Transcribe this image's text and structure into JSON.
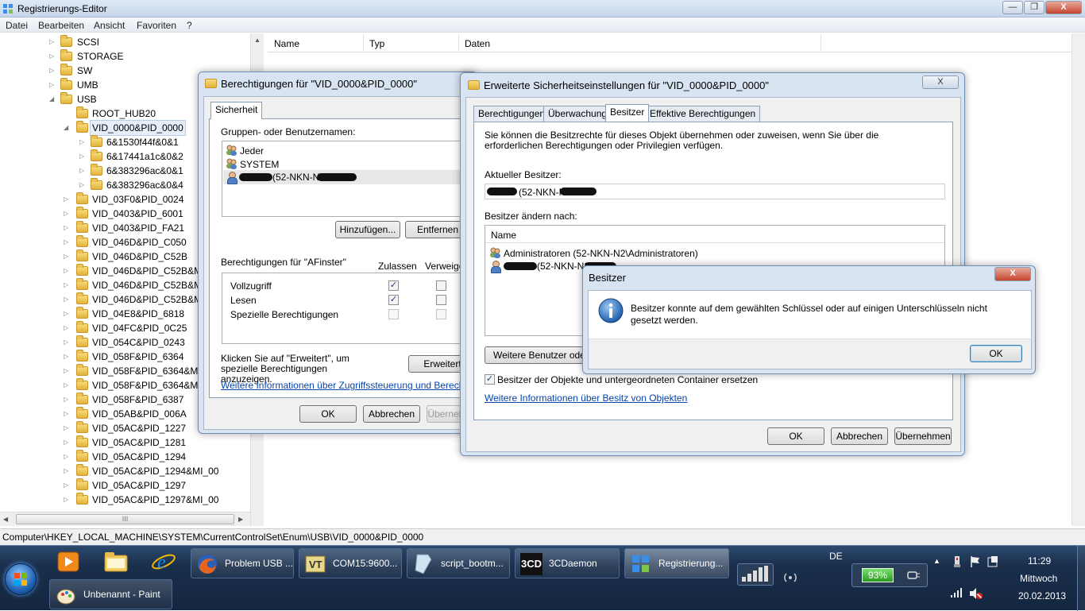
{
  "window": {
    "title": "Registrierungs-Editor",
    "controls": {
      "minimize": "—",
      "maximize": "❐",
      "close": "X"
    }
  },
  "menu": [
    "Datei",
    "Bearbeiten",
    "Ansicht",
    "Favoriten",
    "?"
  ],
  "tree": {
    "items": [
      {
        "label": "SCSI"
      },
      {
        "label": "STORAGE"
      },
      {
        "label": "SW"
      },
      {
        "label": "UMB"
      },
      {
        "label": "USB"
      },
      {
        "label": "ROOT_HUB20"
      },
      {
        "label": "VID_0000&PID_0000"
      },
      {
        "label": "6&1530f44f&0&1"
      },
      {
        "label": "6&17441a1c&0&2"
      },
      {
        "label": "6&383296ac&0&1"
      },
      {
        "label": "6&383296ac&0&4"
      },
      {
        "label": "VID_03F0&PID_0024"
      },
      {
        "label": "VID_0403&PID_6001"
      },
      {
        "label": "VID_0403&PID_FA21"
      },
      {
        "label": "VID_046D&PID_C050"
      },
      {
        "label": "VID_046D&PID_C52B"
      },
      {
        "label": "VID_046D&PID_C52B&MI"
      },
      {
        "label": "VID_046D&PID_C52B&MI"
      },
      {
        "label": "VID_046D&PID_C52B&MI"
      },
      {
        "label": "VID_04E8&PID_6818"
      },
      {
        "label": "VID_04FC&PID_0C25"
      },
      {
        "label": "VID_054C&PID_0243"
      },
      {
        "label": "VID_058F&PID_6364"
      },
      {
        "label": "VID_058F&PID_6364&MI_"
      },
      {
        "label": "VID_058F&PID_6364&MI_"
      },
      {
        "label": "VID_058F&PID_6387"
      },
      {
        "label": "VID_05AB&PID_006A"
      },
      {
        "label": "VID_05AC&PID_1227"
      },
      {
        "label": "VID_05AC&PID_1281"
      },
      {
        "label": "VID_05AC&PID_1294"
      },
      {
        "label": "VID_05AC&PID_1294&MI_00"
      },
      {
        "label": "VID_05AC&PID_1297"
      },
      {
        "label": "VID_05AC&PID_1297&MI_00"
      }
    ],
    "hscroll_label": "III"
  },
  "list": {
    "columns": [
      "Name",
      "Typ",
      "Daten"
    ]
  },
  "statusbar": "Computer\\HKEY_LOCAL_MACHINE\\SYSTEM\\CurrentControlSet\\Enum\\USB\\VID_0000&PID_0000",
  "perm_dialog": {
    "title": "Berechtigungen für \"VID_0000&PID_0000\"",
    "tab": "Sicherheit",
    "groups_label": "Gruppen- oder Benutzernamen:",
    "users": [
      "Jeder",
      "SYSTEM",
      "(52-NKN-N2"
    ],
    "add_button": "Hinzufügen...",
    "remove_button": "Entfernen",
    "perms_for": "Berechtigungen für \"AFinster\"",
    "col_allow": "Zulassen",
    "col_deny": "Verweigern",
    "perms": [
      {
        "name": "Vollzugriff",
        "allow": true,
        "deny": false,
        "disabled": false
      },
      {
        "name": "Lesen",
        "allow": true,
        "deny": false,
        "disabled": false
      },
      {
        "name": "Spezielle Berechtigungen",
        "allow": false,
        "deny": false,
        "disabled": true
      }
    ],
    "advanced_hint": "Klicken Sie auf \"Erweitert\", um spezielle Berechtigungen anzuzeigen.",
    "advanced_button": "Erweitert",
    "info_link": "Weitere Informationen über Zugriffssteuerung und Berechtigungen",
    "ok": "OK",
    "cancel": "Abbrechen",
    "apply": "Übernehmen"
  },
  "adv_dialog": {
    "title": "Erweiterte Sicherheitseinstellungen für \"VID_0000&PID_0000\"",
    "tabs": [
      "Berechtigungen",
      "Überwachung",
      "Besitzer",
      "Effektive Berechtigungen"
    ],
    "active_tab": "Besitzer",
    "intro": "Sie können die Besitzrechte für dieses Objekt übernehmen oder zuweisen, wenn Sie über die erforderlichen Berechtigungen oder Privilegien verfügen.",
    "current_owner_label": "Aktueller Besitzer:",
    "current_owner": "(52-NKN-N2",
    "change_owner_label": "Besitzer ändern nach:",
    "name_header": "Name",
    "owners": [
      "Administratoren (52-NKN-N2\\Administratoren)",
      "(52-NKN-N2\\"
    ],
    "more_users_button": "Weitere Benutzer oder (",
    "replace_checkbox": "Besitzer der Objekte und untergeordneten Container ersetzen",
    "replace_checked": true,
    "info_link": "Weitere Informationen über Besitz von Objekten",
    "ok": "OK",
    "cancel": "Abbrechen",
    "apply": "Übernehmen",
    "close": "X"
  },
  "msg_dialog": {
    "title": "Besitzer",
    "message": "Besitzer konnte auf dem gewählten Schlüssel oder auf einigen Unterschlüsseln nicht gesetzt werden.",
    "ok": "OK",
    "close": "X",
    "icon": "info-icon"
  },
  "taskbar": {
    "tasks": [
      {
        "label": "Problem USB ...",
        "icon": "firefox-icon"
      },
      {
        "label": "COM15:9600...",
        "icon": "terminal-icon"
      },
      {
        "label": "script_bootm...",
        "icon": "document-icon"
      },
      {
        "label": "3CDaemon",
        "icon": "3cdaemon-icon",
        "badge": "3CD"
      },
      {
        "label": "Registrierung...",
        "icon": "regedit-icon"
      },
      {
        "label": "Unbenannt - Paint",
        "icon": "paint-icon"
      }
    ],
    "language": "DE",
    "battery": "93%",
    "time": "11:29",
    "day": "Mittwoch",
    "date": "20.02.2013"
  }
}
